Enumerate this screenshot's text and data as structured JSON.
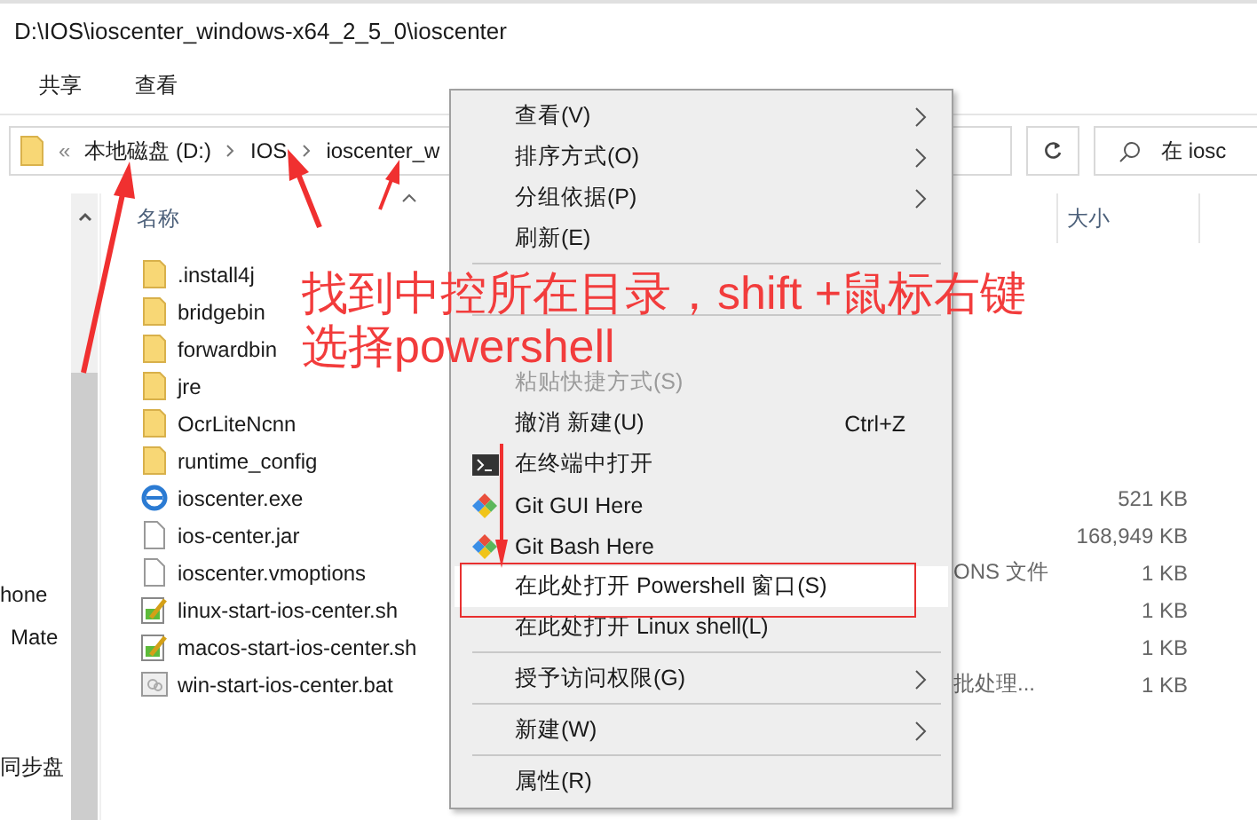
{
  "window": {
    "title": "D:\\IOS\\ioscenter_windows-x64_2_5_0\\ioscenter"
  },
  "ribbon_tabs": [
    {
      "label": "共享"
    },
    {
      "label": "查看"
    }
  ],
  "address_bar": {
    "overflow": "«",
    "segments": [
      "本地磁盘 (D:)",
      "IOS",
      "ioscenter_w"
    ]
  },
  "search": {
    "placeholder": "在 iosc"
  },
  "columns": [
    {
      "label": "名称",
      "sorted": true
    },
    {
      "label": "大小",
      "sorted": false
    }
  ],
  "nav_items": [
    {
      "label": "hone"
    },
    {
      "label": "Mate"
    },
    {
      "label": "同步盘"
    }
  ],
  "files": [
    {
      "name": ".install4j",
      "kind": "folder"
    },
    {
      "name": "bridgebin",
      "kind": "folder"
    },
    {
      "name": "forwardbin",
      "kind": "folder"
    },
    {
      "name": "jre",
      "kind": "folder"
    },
    {
      "name": "OcrLiteNcnn",
      "kind": "folder"
    },
    {
      "name": "runtime_config",
      "kind": "folder"
    },
    {
      "name": "ioscenter.exe",
      "kind": "exe",
      "size": "521 KB"
    },
    {
      "name": "ios-center.jar",
      "kind": "file",
      "size": "168,949 KB"
    },
    {
      "name": "ioscenter.vmoptions",
      "kind": "file",
      "type": "ONS 文件",
      "size": "1 KB"
    },
    {
      "name": "linux-start-ios-center.sh",
      "kind": "script",
      "size": "1 KB"
    },
    {
      "name": "macos-start-ios-center.sh",
      "kind": "script",
      "size": "1 KB"
    },
    {
      "name": "win-start-ios-center.bat",
      "kind": "batch",
      "type": "批处理...",
      "size": "1 KB"
    }
  ],
  "context_menu": {
    "items": [
      {
        "kind": "item",
        "label": "查看(V)",
        "submenu": true,
        "disabled": false,
        "selected": false
      },
      {
        "kind": "item",
        "label": "排序方式(O)",
        "submenu": true,
        "disabled": false,
        "selected": false
      },
      {
        "kind": "item",
        "label": "分组依据(P)",
        "submenu": true,
        "disabled": false,
        "selected": false
      },
      {
        "kind": "item",
        "label": "刷新(E)",
        "submenu": false,
        "disabled": false,
        "selected": false
      },
      {
        "kind": "separator"
      },
      {
        "kind": "covered"
      },
      {
        "kind": "separator"
      },
      {
        "kind": "covered"
      },
      {
        "kind": "item",
        "label": "粘贴快捷方式(S)",
        "submenu": false,
        "disabled": true,
        "selected": false
      },
      {
        "kind": "item",
        "label": "撤消 新建(U)",
        "shortcut": "Ctrl+Z",
        "submenu": false,
        "disabled": false,
        "selected": false
      },
      {
        "kind": "terminal_item",
        "label": "在终端中打开",
        "submenu": false,
        "disabled": false,
        "selected": false
      },
      {
        "kind": "git_item",
        "label": "Git GUI Here",
        "submenu": false,
        "disabled": false,
        "selected": false
      },
      {
        "kind": "git_item",
        "label": "Git Bash Here",
        "submenu": false,
        "disabled": false,
        "selected": false
      },
      {
        "kind": "item",
        "label": "在此处打开 Powershell 窗口(S)",
        "submenu": false,
        "disabled": false,
        "selected": true
      },
      {
        "kind": "item",
        "label": "在此处打开 Linux shell(L)",
        "submenu": false,
        "disabled": false,
        "selected": false
      },
      {
        "kind": "separator"
      },
      {
        "kind": "item",
        "label": "授予访问权限(G)",
        "submenu": true,
        "disabled": false,
        "selected": false
      },
      {
        "kind": "separator"
      },
      {
        "kind": "item",
        "label": "新建(W)",
        "submenu": true,
        "disabled": false,
        "selected": false
      },
      {
        "kind": "separator"
      },
      {
        "kind": "item",
        "label": "属性(R)",
        "submenu": false,
        "disabled": false,
        "selected": false
      }
    ]
  },
  "annotation": {
    "lines": [
      "找到中控所在目录，shift +鼠标右键",
      "选择powershell"
    ]
  }
}
